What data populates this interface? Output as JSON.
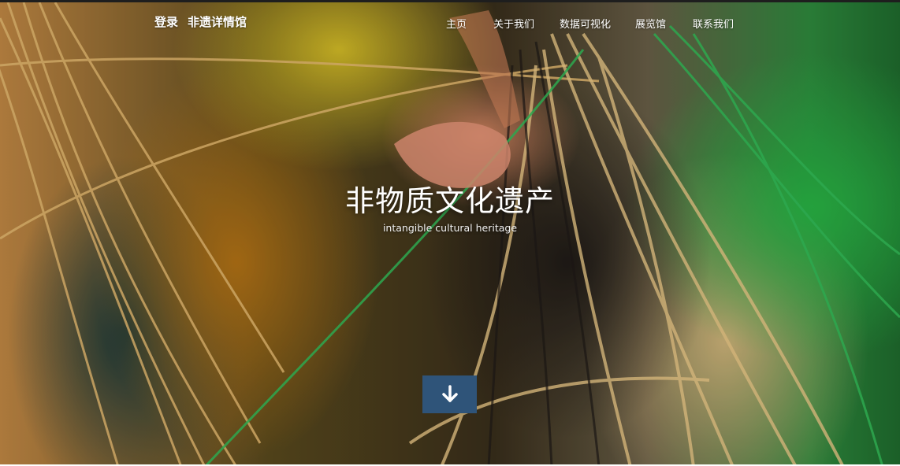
{
  "header": {
    "login": "登录",
    "brand": "非遗详情馆"
  },
  "nav": {
    "items": [
      "主页",
      "关于我们",
      "数据可视化",
      "展览馆",
      "联系我们"
    ]
  },
  "hero": {
    "title": "非物质文化遗产",
    "subtitle": "intangible cultural heritage",
    "scroll_icon": "arrow-down-icon"
  },
  "colors": {
    "scroll_button": "#2f5479",
    "text": "#ffffff"
  }
}
